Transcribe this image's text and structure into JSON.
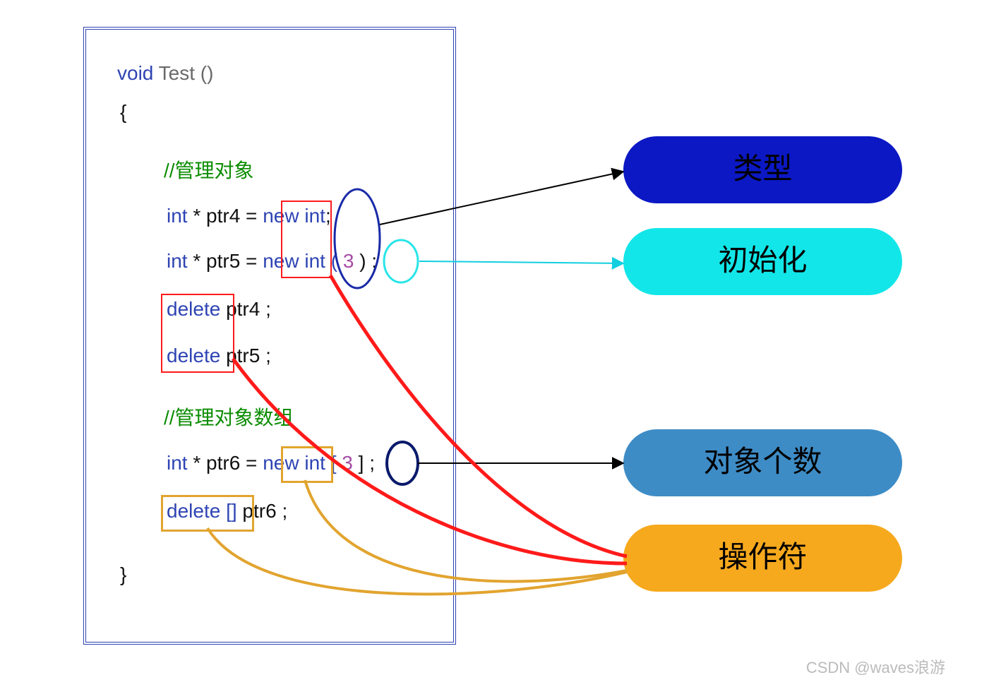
{
  "code": {
    "header": {
      "void": "void",
      "fn": " Test ()"
    },
    "brace_open": "{",
    "comment1": "//管理对象",
    "l1": {
      "int": "int",
      "star": " * ptr4 = ",
      "new": "new",
      "int2": " int",
      "tail": ";"
    },
    "l2": {
      "int": "int",
      "star": " * ptr5 = ",
      "new": "new",
      "int2": " int (",
      "num": " 3 ",
      "tail": ") ;"
    },
    "l3": {
      "del": "delete",
      "rest": "      ptr4 ;"
    },
    "l4": {
      "del": "delete",
      "rest": "      ptr5 ;"
    },
    "comment2": "//管理对象数组",
    "l5": {
      "int": "int",
      "star": " * ptr6 = ",
      "new": "new",
      "int2": " int [",
      "num": " 3 ",
      "tail": "] ;"
    },
    "l6": {
      "del": "delete []",
      "rest": " ptr6 ;"
    },
    "brace_close": "}"
  },
  "pills": {
    "type": "类型",
    "init": "初始化",
    "count": "对象个数",
    "op": "操作符"
  },
  "watermark": "CSDN @waves浪游",
  "colors": {
    "pill_type": "#0b18c3",
    "pill_init": "#12e6e9",
    "pill_count": "#3e8cc6",
    "pill_op": "#f6a91d"
  }
}
